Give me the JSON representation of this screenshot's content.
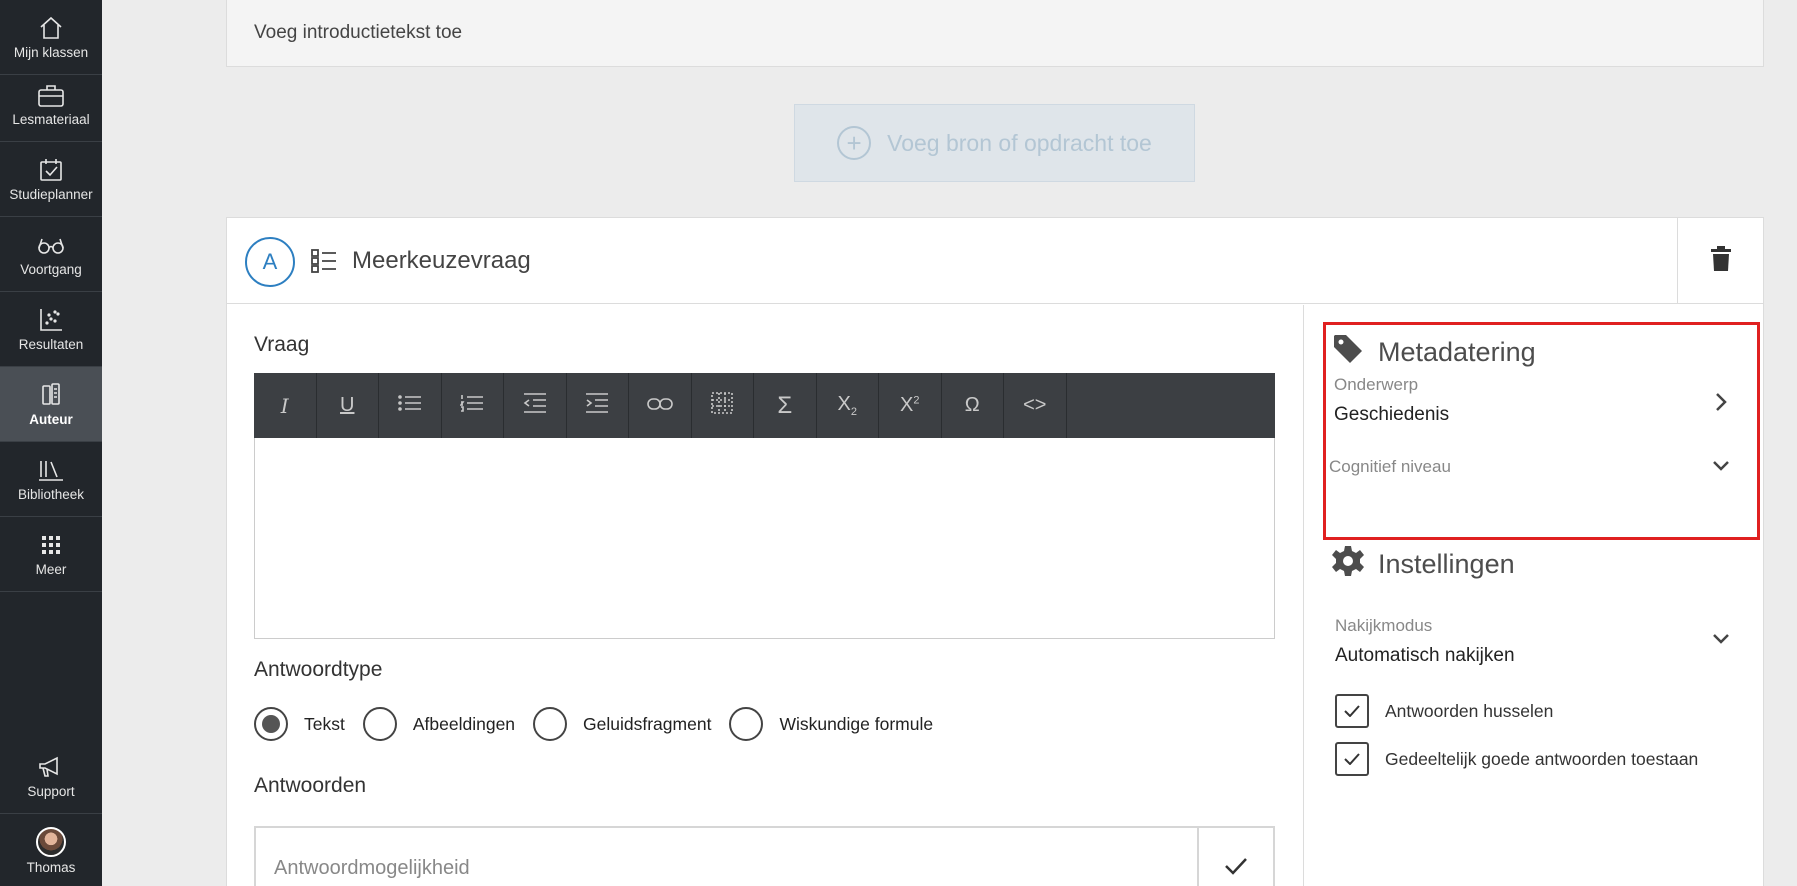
{
  "sidebar": {
    "items": [
      {
        "label": "Mijn klassen",
        "icon": "home-icon"
      },
      {
        "label": "Lesmateriaal",
        "icon": "briefcase-icon"
      },
      {
        "label": "Studieplanner",
        "icon": "calendar-check-icon"
      },
      {
        "label": "Voortgang",
        "icon": "glasses-icon"
      },
      {
        "label": "Resultaten",
        "icon": "scatter-chart-icon"
      },
      {
        "label": "Auteur",
        "icon": "author-icon",
        "active": true
      },
      {
        "label": "Bibliotheek",
        "icon": "library-icon"
      },
      {
        "label": "Meer",
        "icon": "grid-icon"
      }
    ],
    "support_label": "Support",
    "user_name": "Thomas"
  },
  "intro": {
    "placeholder": "Voeg introductietekst toe"
  },
  "add_source": {
    "label": "Voeg bron of opdracht toe"
  },
  "question": {
    "badge": "A",
    "type_title": "Meerkeuzevraag",
    "vraag_label": "Vraag",
    "toolbar": [
      "italic-icon",
      "underline-icon",
      "bullet-list-icon",
      "numbered-list-icon",
      "outdent-icon",
      "indent-icon",
      "link-icon",
      "table-icon",
      "sigma-icon",
      "subscript-icon",
      "superscript-icon",
      "omega-icon",
      "code-icon"
    ],
    "answer_type_label": "Antwoordtype",
    "answer_types": [
      {
        "label": "Tekst",
        "selected": true
      },
      {
        "label": "Afbeeldingen",
        "selected": false
      },
      {
        "label": "Geluidsfragment",
        "selected": false
      },
      {
        "label": "Wiskundige formule",
        "selected": false
      }
    ],
    "answers_label": "Antwoorden",
    "answer_placeholder": "Antwoordmogelijkheid"
  },
  "metadata": {
    "title": "Metadatering",
    "subject_label": "Onderwerp",
    "subject_value": "Geschiedenis",
    "cognitive_label": "Cognitief niveau"
  },
  "settings": {
    "title": "Instellingen",
    "grading_label": "Nakijkmodus",
    "grading_value": "Automatisch nakijken",
    "checkboxes": [
      {
        "label": "Antwoorden husselen",
        "checked": true
      },
      {
        "label": "Gedeeltelijk goede antwoorden toestaan",
        "checked": true
      }
    ]
  },
  "colors": {
    "accent": "#2d7fc1",
    "highlight": "#e02020",
    "sidebar": "#22262b"
  }
}
